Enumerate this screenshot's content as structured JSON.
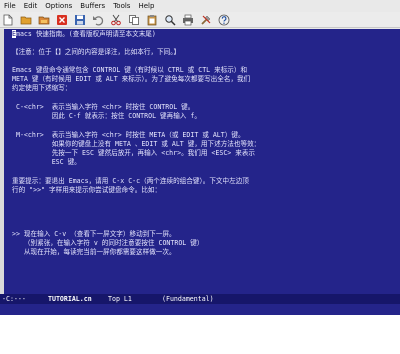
{
  "menu": [
    "File",
    "Edit",
    "Options",
    "Buffers",
    "Tools",
    "Help"
  ],
  "toolbar_icons": [
    "new-file-icon",
    "open-folder-icon",
    "open-dir-icon",
    "close-icon",
    "save-icon",
    "undo-icon",
    "cut-icon",
    "copy-icon",
    "paste-icon",
    "search-icon",
    "print-icon",
    "preferences-icon",
    "help-icon"
  ],
  "buffer": {
    "cursor_char": "E",
    "line_first_rest": "macs 快速指南。(查看版权声明请至本文末尾)",
    "lines": [
      "【注意：位于【】之间的内容是译注，比如本行，下同。】",
      "",
      "Emacs 键盘命令通常包含 CONTROL 键（有时候以 CTRL 或 CTL 来标示）和",
      "META 键（有时候用 EDIT 或 ALT 来标示）。为了避免每次都要写出全名，我们",
      "约定使用下述缩写：",
      "",
      " C-<chr>  表示当输入字符 <chr> 时按住 CONTROL 键。",
      "          因此 C-f 就表示：按住 CONTROL 键再输入 f。",
      "",
      " M-<chr>  表示当输入字符 <chr> 时按住 META（或 EDIT 或 ALT）键。",
      "          如果你的键盘上没有 META 、EDIT 或 ALT 键，用下述方法也等效：",
      "          先按一下 ESC 键然后放开，再输入 <chr>。我们用 <ESC> 来表示",
      "          ESC 键。",
      "",
      "重要提示：要退出 Emacs，请用 C-x C-c（两个连续的组合键）。下文中左边顶",
      "行的 \">>\" 字样用来提示你尝试键盘命令。比如：",
      "",
      "",
      "",
      "",
      "",
      "",
      "",
      ">> 现在输入 C-v （查看下一屏文字）移动到下一屏。",
      "   （别紧张，在输入字符 v 的同时注意要按住 CONTROL 键）",
      "   从现在开始，每读完当前一屏你都需要这样做一次。"
    ]
  },
  "modeline": {
    "left": "-C:---",
    "filename": "TUTORIAL.cn",
    "position": "Top L1",
    "mode": "(Fundamental)"
  },
  "echo": ""
}
